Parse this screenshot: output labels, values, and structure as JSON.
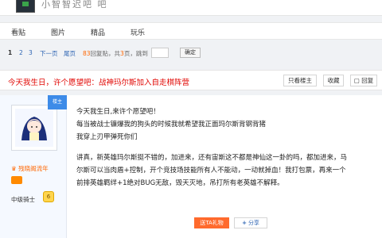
{
  "banner": {
    "forum_title": "小智智迟吧 吧"
  },
  "nav": {
    "tabs": [
      "看贴",
      "图片",
      "精品",
      "玩乐"
    ]
  },
  "pager": {
    "pages": [
      "1",
      "2",
      "3"
    ],
    "next": "下一页",
    "last": "尾页",
    "reply_count": "83",
    "reply_text": "回复贴，共",
    "page_total": "3",
    "page_text": "页，跳到",
    "go_label": "确定"
  },
  "thread": {
    "title": "今天我生日，许个愿望吧：战神玛尔斯加入自走棋阵营",
    "only_author": "只看楼主",
    "favorite": "收藏",
    "reply": "回复"
  },
  "post": {
    "badge": "楼主",
    "author_name": "残晓阁流年",
    "level_name": "中级骑士",
    "level_num": "6",
    "lines": [
      "今天我生日,来许个愿望吧！",
      "每当被战士镰爆我的狗头的时候我就希望我正面玛尔斯背钢背猪",
      "我穿上刃甲弹死你们",
      "讲真，新英雄玛尔斯挺不错的，加进来，还有宙斯这不都是神仙这一卦的吗，都加进来，马",
      "尔斯可以当肉盾+控制，开个竞技场技能所有人不能动，一动就掉血！我打包票，再来一个",
      "前排英雄羁绊+1绝对BUG无敌，毁天灭地，吊打所有老英雄不解释。"
    ],
    "gift_label": "送TA礼物",
    "share_label": "分享"
  },
  "colors": {
    "title_red": "#e10602",
    "link_blue": "#2d64b3",
    "accent_orange": "#ff6a2d"
  }
}
